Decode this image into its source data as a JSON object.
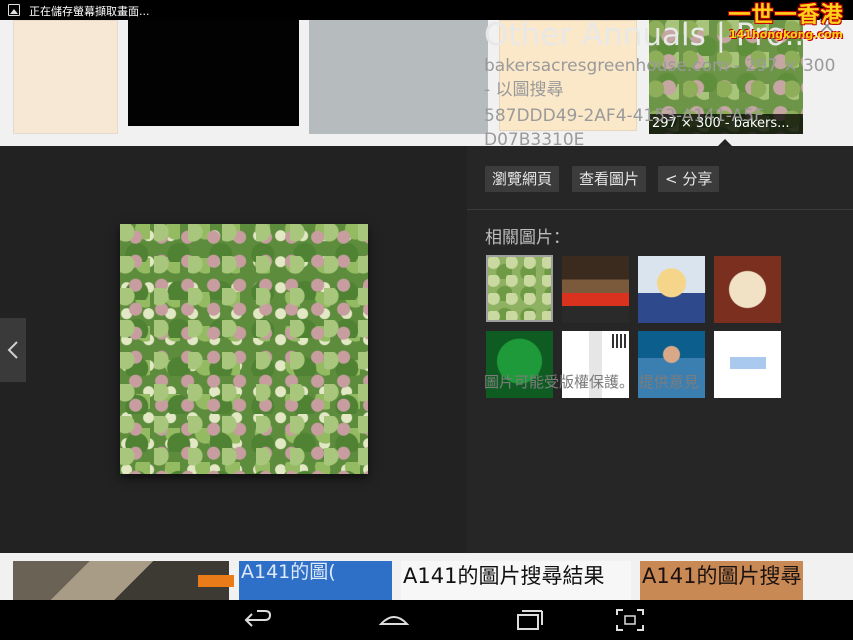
{
  "status_bar": {
    "text": "正在儲存螢幕擷取畫面...",
    "icon": "screenshot-icon"
  },
  "watermark": {
    "main": "一世一香港",
    "sub": "141hongkong.com"
  },
  "top_thumbnails": {
    "selected_caption": "297 × 300 - bakers..."
  },
  "detail": {
    "title": "Other Annuals | Pro...",
    "source": "bakersacresgreenhouse.com - 297 × 300 - 以圖搜尋",
    "hash": "587DDD49-2AF4-4153-A141-A5FD07B3310E",
    "buttons": {
      "visit": "瀏覽網頁",
      "view": "查看圖片",
      "share": "< 分享"
    },
    "related_label": "相關圖片：",
    "overlay_text": "圖片可能受版權保護。 提供意見"
  },
  "bottom_thumbnails": [
    {
      "text": ""
    },
    {
      "text": "A141的圖("
    },
    {
      "text": "A141的圖片搜尋結果"
    },
    {
      "text": "A141的圖片搜尋"
    }
  ],
  "icons": {
    "prev": "chevron-left-icon",
    "next": "chevron-right-icon",
    "close": "close-icon",
    "back": "back-icon",
    "home": "home-icon",
    "recent": "recent-apps-icon",
    "screenshot": "screenshot-icon"
  }
}
